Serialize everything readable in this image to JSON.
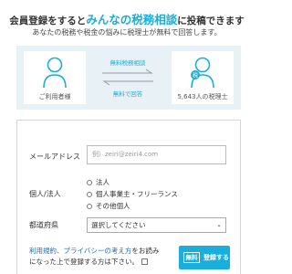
{
  "header": {
    "headline_pre": "会員登録をすると",
    "headline_accent": "みんなの税務相談",
    "headline_post": "に投稿できます",
    "subline": "あなたの税務や税金の悩みに税理士が無料で回答します。"
  },
  "hero": {
    "user_caption": "ご利用者様",
    "accountant_caption": "5,643人の税理士",
    "accountant_badge": "税",
    "flow_top": "無料税務相談",
    "flow_bottom": "無料で回答"
  },
  "form": {
    "email_label": "メールアドレス",
    "email_placeholder": "例）zeiri@zeiri4.com",
    "type_label": "個人/法人",
    "options": [
      "法人",
      "個人事業主・フリーランス",
      "その他個人"
    ],
    "prefecture_label": "都道府県",
    "prefecture_value": "選択してください",
    "terms_link": "利用規約、プライバシーの考え方",
    "terms_text_1": "をお読み",
    "terms_text_2": "になった上で登録する方は下さい。",
    "submit_badge": "無料",
    "submit_label": "登録する"
  },
  "colors": {
    "accent": "#19aedb",
    "hero_bg": "#e8f1f6",
    "link": "#1a6fc2"
  }
}
